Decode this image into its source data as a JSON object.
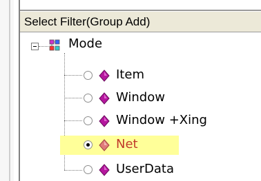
{
  "panel": {
    "header_label": "Select Filter(Group Add)"
  },
  "tree": {
    "root": {
      "label": "Mode",
      "icon": "grouped-nodes-icon",
      "expanded": true
    },
    "items": [
      {
        "label": "Item",
        "icon": "magenta-gem-icon",
        "selected": false
      },
      {
        "label": "Window",
        "icon": "magenta-gem-icon",
        "selected": false
      },
      {
        "label": "Window +Xing",
        "icon": "magenta-gem-icon",
        "selected": false
      },
      {
        "label": "Net",
        "icon": "magenta-gem-icon",
        "selected": true
      },
      {
        "label": "UserData",
        "icon": "magenta-gem-icon",
        "selected": false
      }
    ]
  },
  "colors": {
    "selection_highlight": "#ffff99",
    "selected_label": "#c0392b",
    "gem": "#b5179e"
  }
}
